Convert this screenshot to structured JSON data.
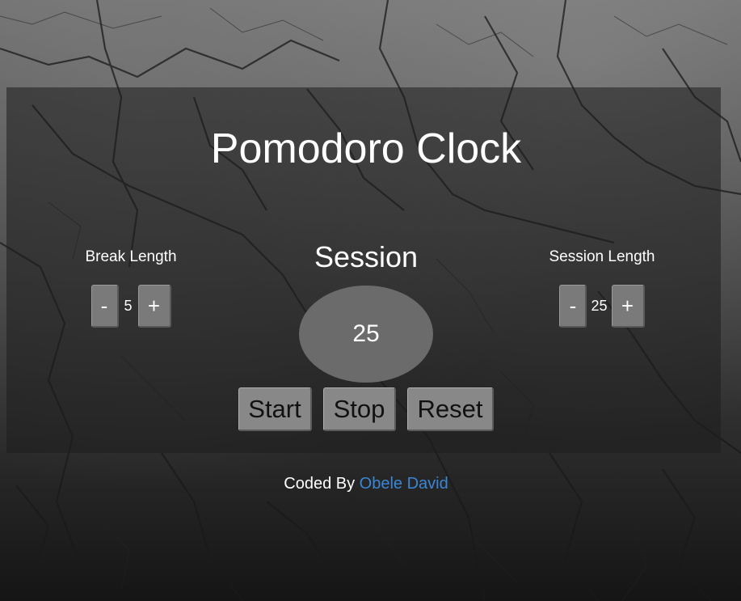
{
  "app": {
    "title": "Pomodoro Clock"
  },
  "break_control": {
    "label": "Break Length",
    "decrement_label": "-",
    "value": "5",
    "increment_label": "+"
  },
  "session_control": {
    "label": "Session Length",
    "decrement_label": "-",
    "value": "25",
    "increment_label": "+"
  },
  "timer": {
    "mode_label": "Session",
    "display": "25"
  },
  "actions": {
    "start_label": "Start",
    "stop_label": "Stop",
    "reset_label": "Reset"
  },
  "footer": {
    "prefix": "Coded By",
    "author_link": "Obele David"
  },
  "colors": {
    "link": "#3a86d4",
    "timer_bg": "#6b6b6b",
    "button_bg": "#888888"
  }
}
